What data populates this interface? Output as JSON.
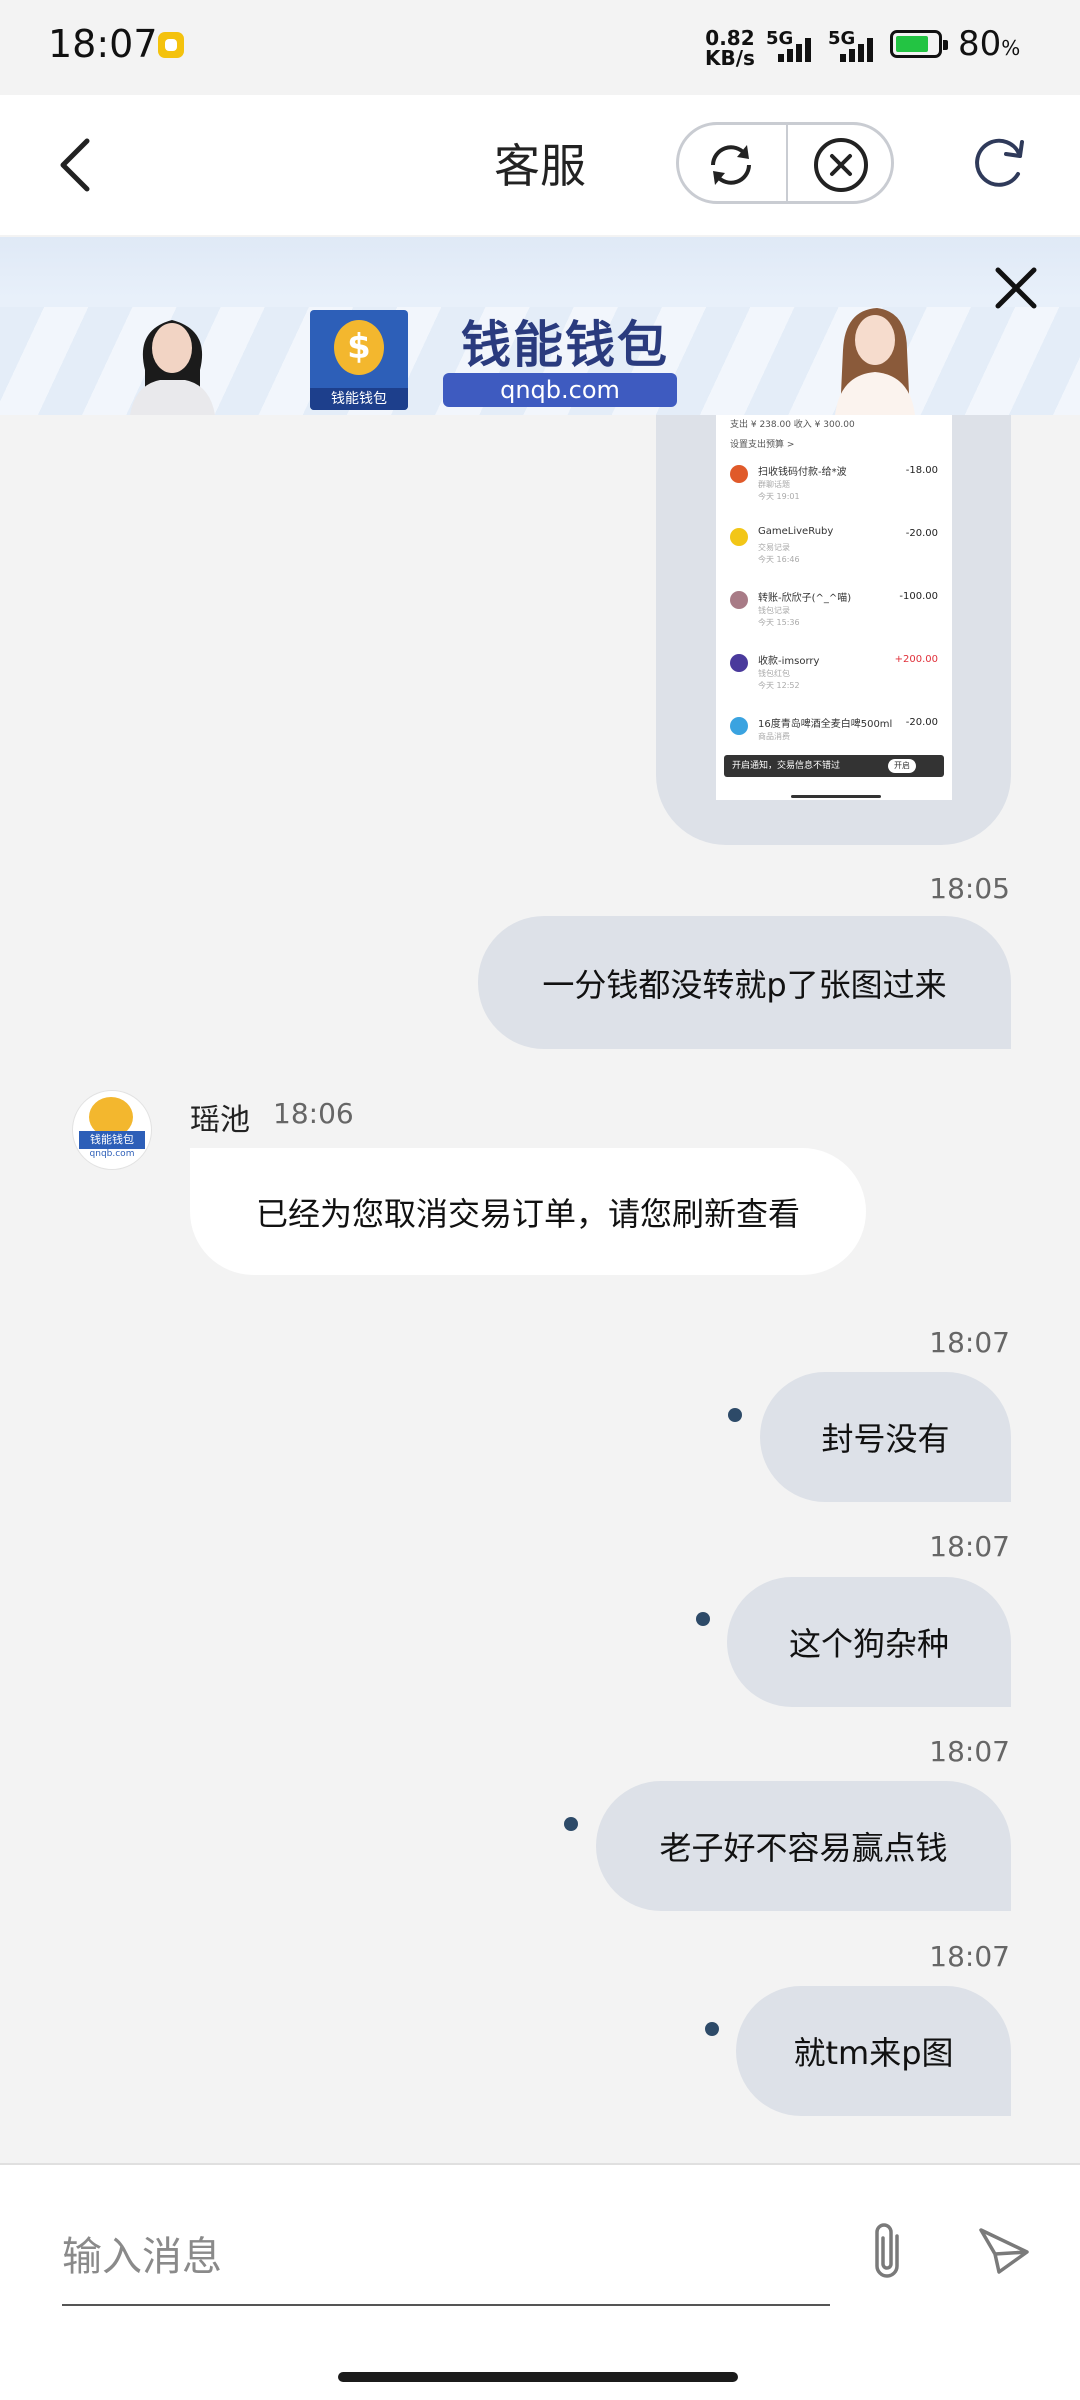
{
  "status_bar": {
    "time": "18:07",
    "net_speed_value": "0.82",
    "net_speed_unit": "KB/s",
    "signal1": "5G",
    "signal2": "5G",
    "battery_percent": "80",
    "battery_unit": "%",
    "battery_level": 0.8,
    "icons": [
      "notification-dot-icon",
      "signal-icon",
      "battery-charging-icon"
    ]
  },
  "header": {
    "title": "客服",
    "icons": [
      "back-icon",
      "switch-icon",
      "close-circle-icon",
      "refresh-icon"
    ]
  },
  "ad": {
    "brand": "钱能钱包",
    "url": "qnqb.com",
    "logo_text": "钱能钱包",
    "icons": [
      "close-icon"
    ]
  },
  "screenshot_image": {
    "top_line": "支出 ¥ 238.00   收入 ¥ 300.00",
    "budget_link": "设置支出预算 >",
    "rows": [
      {
        "name": "扫收钱码付款-给*波",
        "sub": "群聊话题",
        "time": "今天 19:01",
        "amount": "-18.00",
        "color": "#e05a2a"
      },
      {
        "name": "GameLiveRuby",
        "sub": "交易记录",
        "time": "今天 16:46",
        "amount": "-20.00",
        "color": "#f2c617"
      },
      {
        "name": "转账-欣欣子(^_^喵)",
        "sub": "钱包记录",
        "time": "今天 15:36",
        "amount": "-100.00",
        "color": "#a87b86"
      },
      {
        "name": "收款-imsorry",
        "sub": "钱包红包",
        "time": "今天 12:52",
        "amount": "+200.00",
        "color": "#4a3a9c"
      },
      {
        "name": "16度青岛啤酒全麦白啤500ml",
        "sub": "商品消费",
        "time": "",
        "amount": "-20.00",
        "color": "#3aa3e0"
      }
    ],
    "toast": "开启通知，交易信息不错过",
    "toast_btn": "开启"
  },
  "messages": [
    {
      "side": "right",
      "time": "18:05",
      "text": "一分钱都没转就p了张图过来",
      "pending": false
    },
    {
      "side": "left",
      "sender": "瑶池",
      "time": "18:06",
      "text": "已经为您取消交易订单，请您刷新查看",
      "avatar_text": "钱能钱包",
      "avatar_sub": "qnqb.com"
    },
    {
      "side": "right",
      "time": "18:07",
      "text": "封号没有",
      "pending": true
    },
    {
      "side": "right",
      "time": "18:07",
      "text": "这个狗杂种",
      "pending": true
    },
    {
      "side": "right",
      "time": "18:07",
      "text": "老子好不容易赢点钱",
      "pending": true
    },
    {
      "side": "right",
      "time": "18:07",
      "text": "就tm来p图",
      "pending": true
    }
  ],
  "input": {
    "placeholder": "输入消息",
    "value": "",
    "icons": [
      "attach-icon",
      "send-icon"
    ]
  }
}
